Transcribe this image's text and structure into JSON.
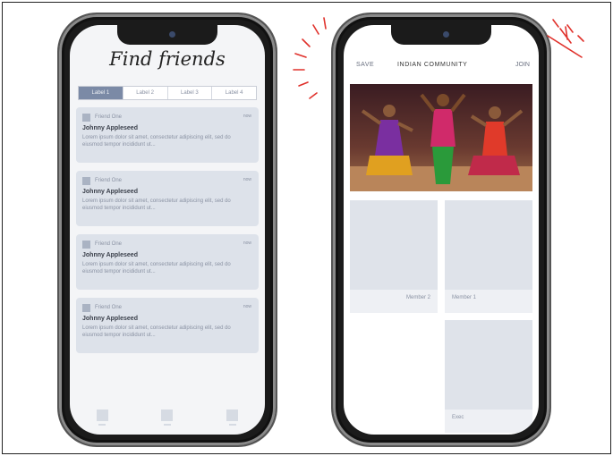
{
  "left_screen": {
    "title": "Find friends",
    "tabs": [
      {
        "label": "Label 1",
        "active": true
      },
      {
        "label": "Label 2",
        "active": false
      },
      {
        "label": "Label 3",
        "active": false
      },
      {
        "label": "Label 4",
        "active": false
      }
    ],
    "cards": [
      {
        "name": "Friend One",
        "time": "now",
        "title": "Johnny Appleseed",
        "text": "Lorem ipsum dolor sit amet, consectetur adipiscing elit, sed do eiusmod tempor incididunt ut..."
      },
      {
        "name": "Friend One",
        "time": "now",
        "title": "Johnny Appleseed",
        "text": "Lorem ipsum dolor sit amet, consectetur adipiscing elit, sed do eiusmod tempor incididunt ut..."
      },
      {
        "name": "Friend One",
        "time": "now",
        "title": "Johnny Appleseed",
        "text": "Lorem ipsum dolor sit amet, consectetur adipiscing elit, sed do eiusmod tempor incididunt ut..."
      },
      {
        "name": "Friend One",
        "time": "now",
        "title": "Johnny Appleseed",
        "text": "Lorem ipsum dolor sit amet, consectetur adipiscing elit, sed do eiusmod tempor incididunt ut..."
      }
    ]
  },
  "right_screen": {
    "save_label": "SAVE",
    "title": "INDIAN COMMUNITY",
    "join_label": "JOIN",
    "members": [
      {
        "label": "Member 1"
      },
      {
        "label": "Member 2"
      },
      {
        "label": "Exec"
      }
    ]
  },
  "colors": {
    "active_tab": "#7b8aa6",
    "card_bg": "#dde2ea",
    "annotation_red": "#e0312b"
  }
}
